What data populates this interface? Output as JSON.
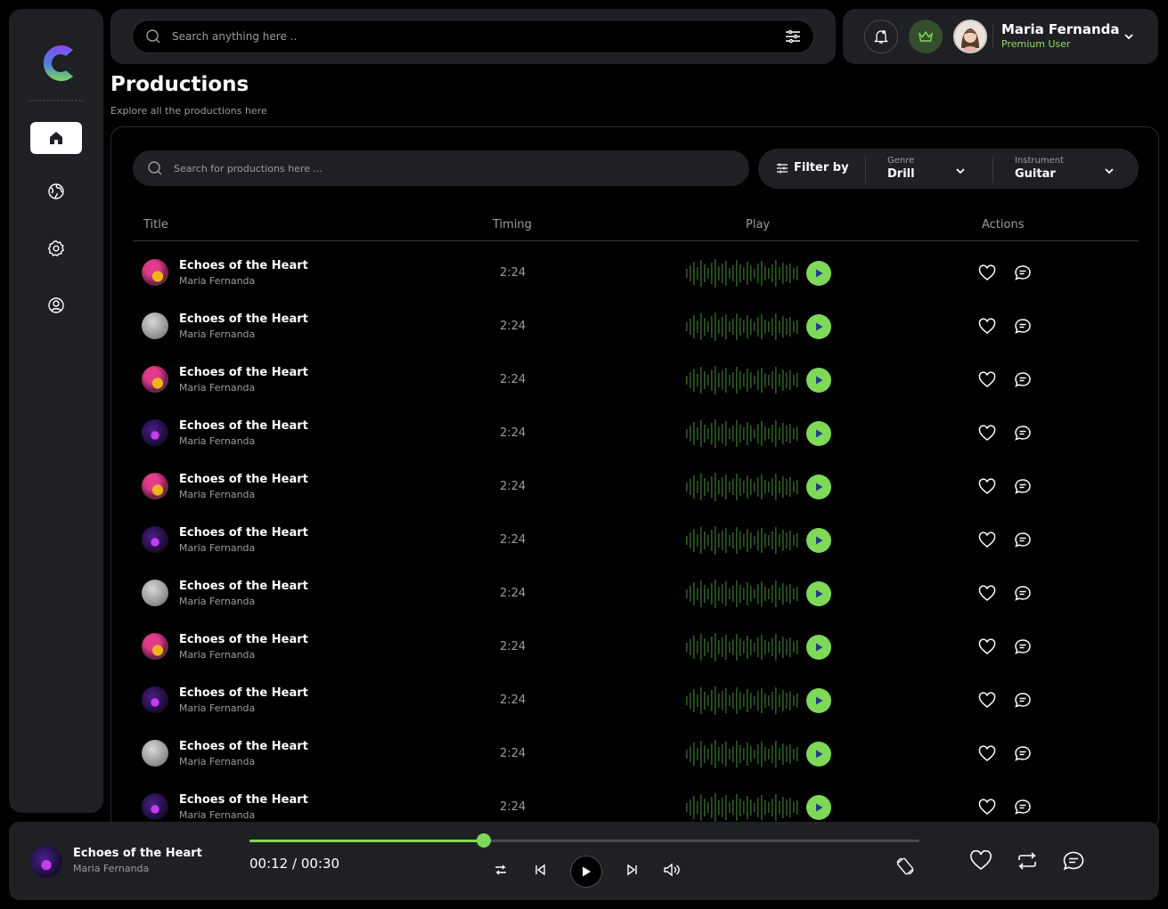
{
  "brand": {
    "accent": "#7ed957",
    "panel": "#1f2024"
  },
  "sidebar": {
    "items": [
      {
        "name": "home",
        "icon": "home-icon",
        "active": true
      },
      {
        "name": "explore",
        "icon": "globe-icon",
        "active": false
      },
      {
        "name": "settings",
        "icon": "gear-icon",
        "active": false
      },
      {
        "name": "profile",
        "icon": "user-circle-icon",
        "active": false
      }
    ]
  },
  "topbar": {
    "search_placeholder": "Search anything here ..",
    "user": {
      "name": "Maria Fernanda",
      "role": "Premium User"
    }
  },
  "page": {
    "title": "Productions",
    "subtitle": "Explore all the productions here"
  },
  "productions": {
    "search_placeholder": "Search for productions here ...",
    "filter_label": "Filter by",
    "filters": {
      "genre": {
        "caption": "Genre",
        "value": "Drill"
      },
      "instrument": {
        "caption": "Instrument",
        "value": "Guitar"
      }
    },
    "columns": {
      "title": "Title",
      "timing": "Timing",
      "play": "Play",
      "actions": "Actions"
    },
    "rows": [
      {
        "title": "Echoes of the Heart",
        "artist": "Maria Fernanda",
        "timing": "2:24",
        "cover": "flower"
      },
      {
        "title": "Echoes of the Heart",
        "artist": "Maria Fernanda",
        "timing": "2:24",
        "cover": "gray"
      },
      {
        "title": "Echoes of the Heart",
        "artist": "Maria Fernanda",
        "timing": "2:24",
        "cover": "flower"
      },
      {
        "title": "Echoes of the Heart",
        "artist": "Maria Fernanda",
        "timing": "2:24",
        "cover": "purple"
      },
      {
        "title": "Echoes of the Heart",
        "artist": "Maria Fernanda",
        "timing": "2:24",
        "cover": "flower"
      },
      {
        "title": "Echoes of the Heart",
        "artist": "Maria Fernanda",
        "timing": "2:24",
        "cover": "purple"
      },
      {
        "title": "Echoes of the Heart",
        "artist": "Maria Fernanda",
        "timing": "2:24",
        "cover": "gray"
      },
      {
        "title": "Echoes of the Heart",
        "artist": "Maria Fernanda",
        "timing": "2:24",
        "cover": "flower"
      },
      {
        "title": "Echoes of the Heart",
        "artist": "Maria Fernanda",
        "timing": "2:24",
        "cover": "purple"
      },
      {
        "title": "Echoes of the Heart",
        "artist": "Maria Fernanda",
        "timing": "2:24",
        "cover": "gray"
      },
      {
        "title": "Echoes of the Heart",
        "artist": "Maria Fernanda",
        "timing": "2:24",
        "cover": "purple"
      }
    ]
  },
  "player": {
    "title": "Echoes of the Heart",
    "artist": "Maria Fernanda",
    "time": "00:12 / 00:30",
    "progress": 0.35
  }
}
